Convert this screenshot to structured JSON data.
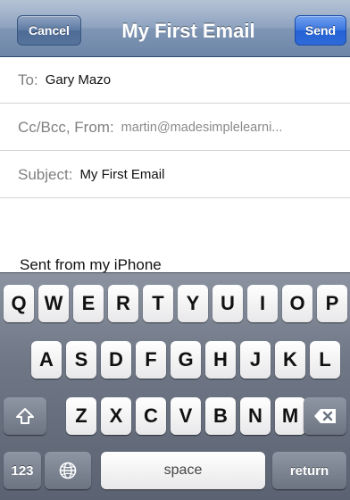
{
  "navbar": {
    "cancel_label": "Cancel",
    "title": "My First Email",
    "send_label": "Send"
  },
  "fields": {
    "to_label": "To:",
    "to_value": "Gary Mazo",
    "cc_label": "Cc/Bcc, From:",
    "cc_value": "martin@madesimplelearni...",
    "subject_label": "Subject:",
    "subject_value": "My First Email"
  },
  "body": {
    "signature": "Sent from my iPhone"
  },
  "keyboard": {
    "row1": [
      "Q",
      "W",
      "E",
      "R",
      "T",
      "Y",
      "U",
      "I",
      "O",
      "P"
    ],
    "row2": [
      "A",
      "S",
      "D",
      "F",
      "G",
      "H",
      "J",
      "K",
      "L"
    ],
    "row3": [
      "Z",
      "X",
      "C",
      "V",
      "B",
      "N",
      "M"
    ],
    "numbers_label": "123",
    "space_label": "space",
    "return_label": "return"
  },
  "icons": {
    "shift": "shift-icon",
    "delete": "backspace-icon",
    "globe": "globe-icon"
  }
}
